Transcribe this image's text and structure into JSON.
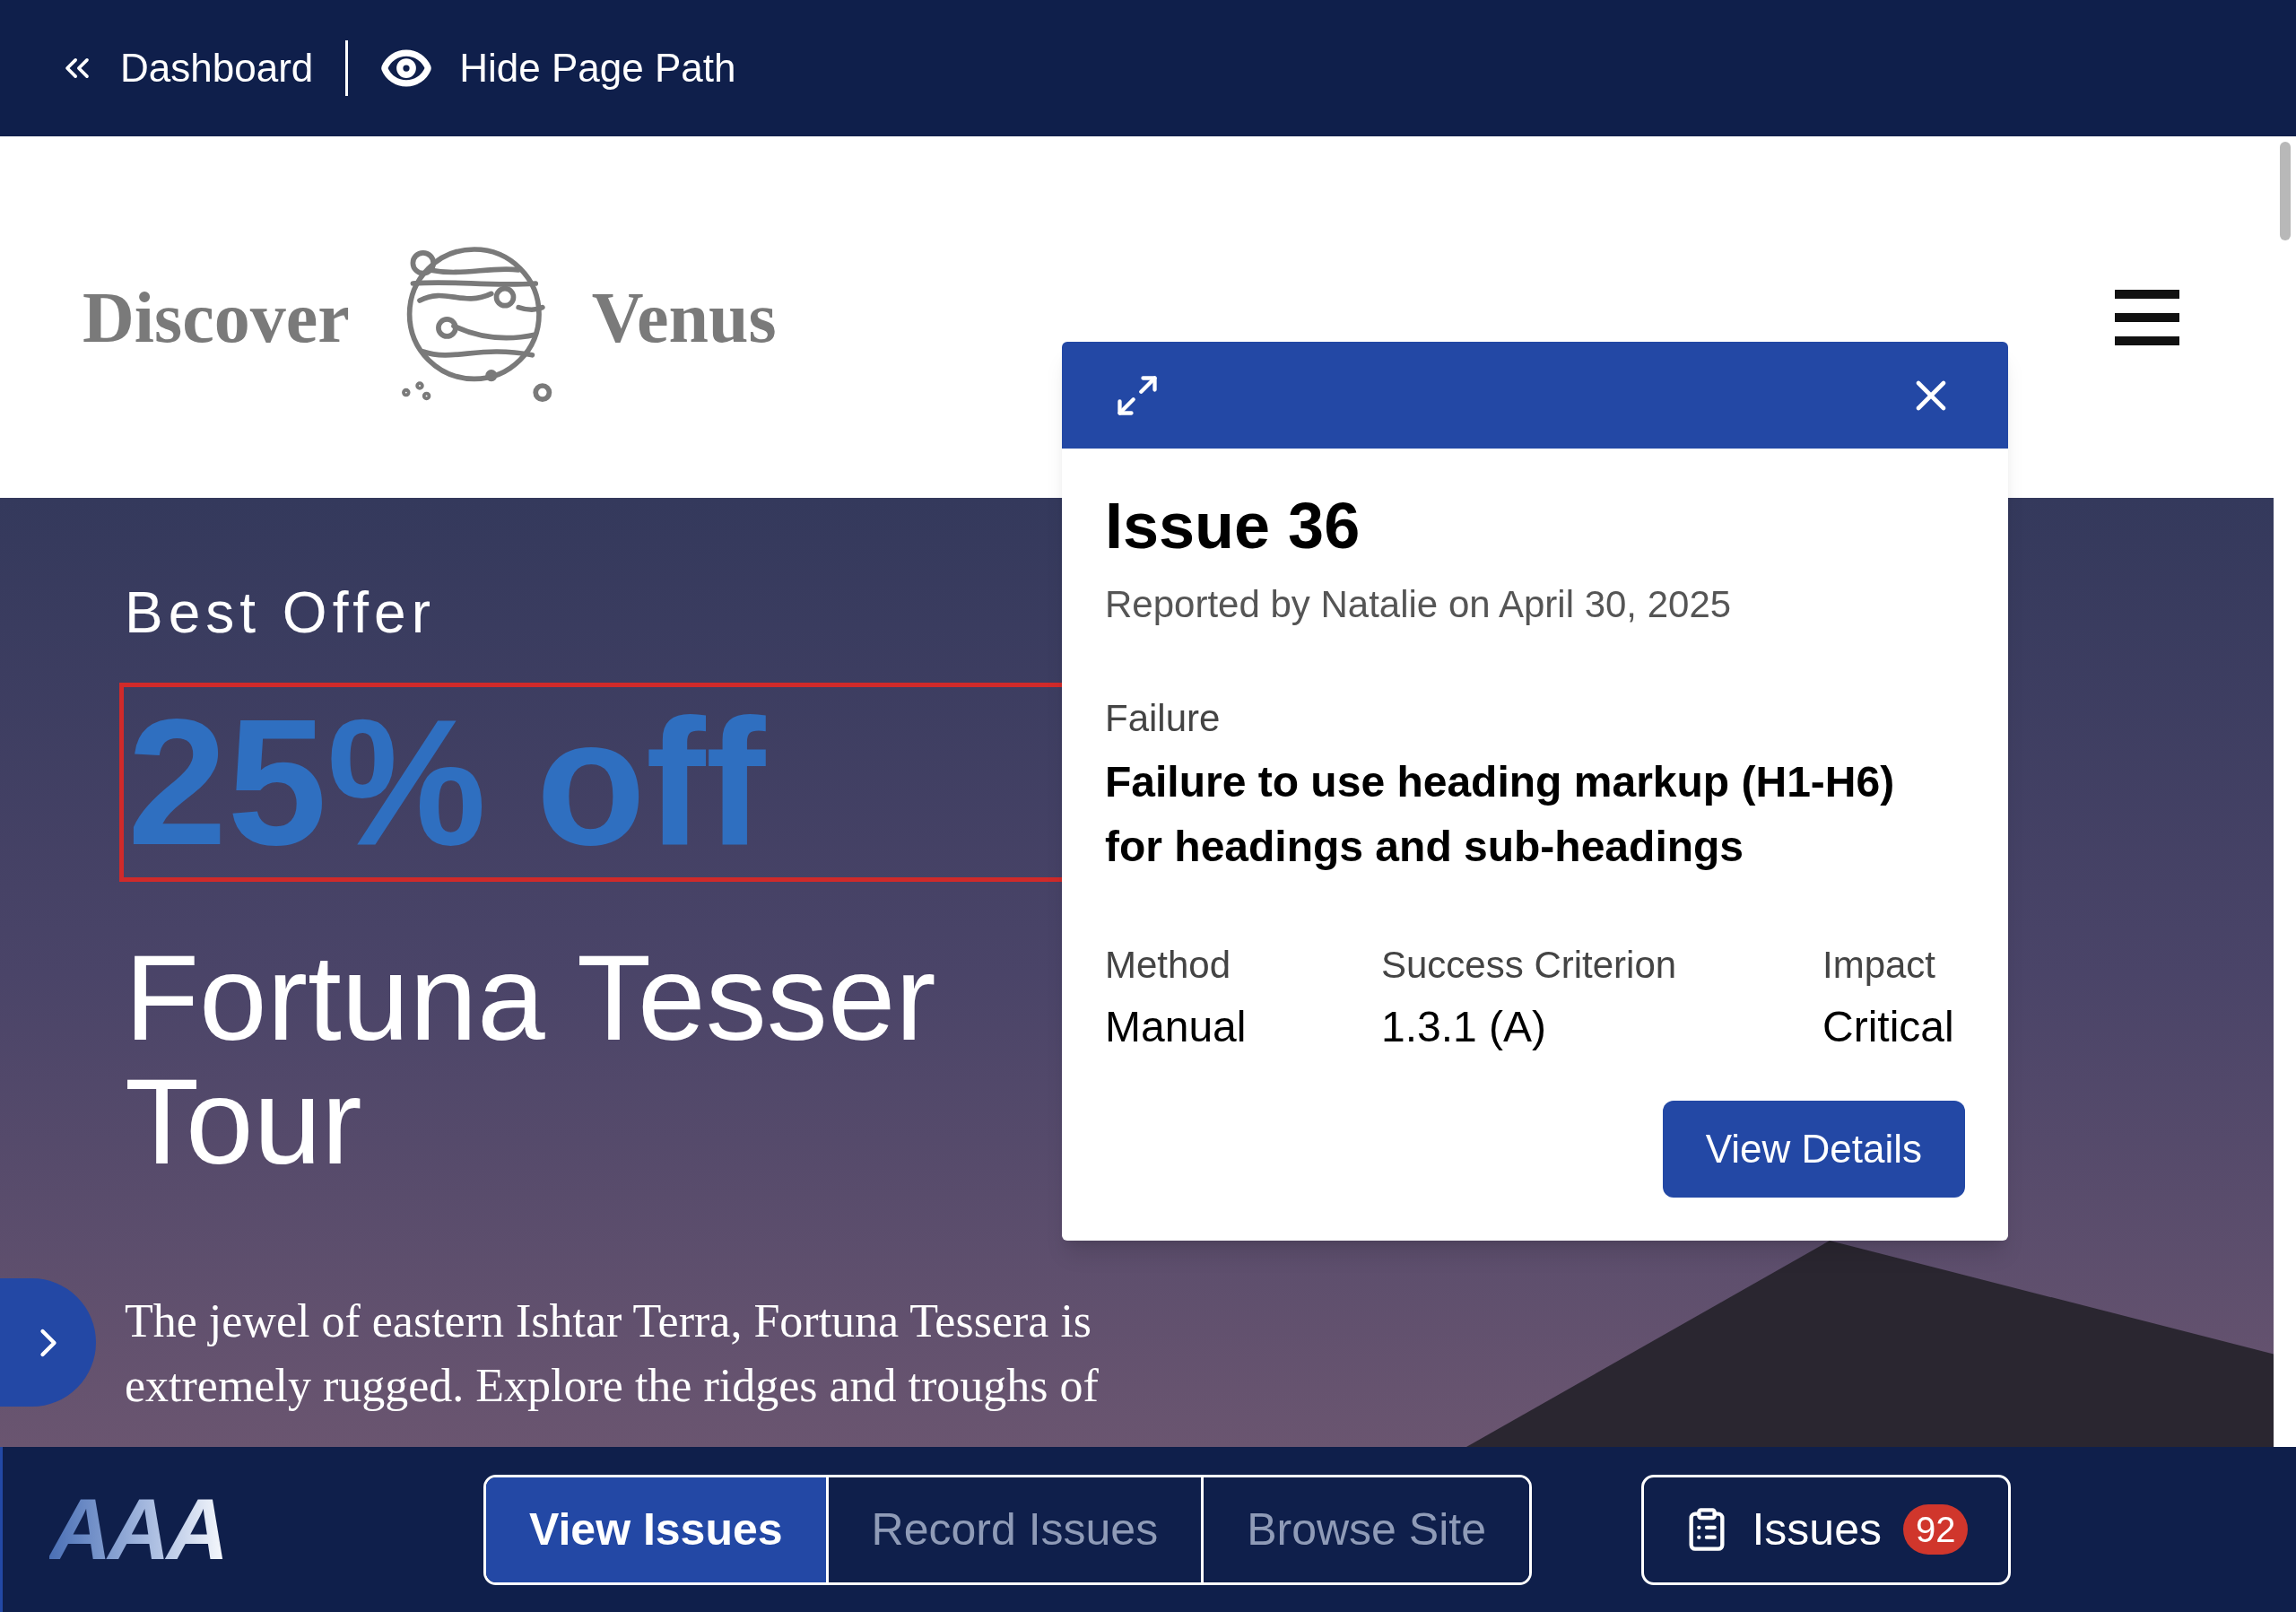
{
  "top_bar": {
    "back_label": "Dashboard",
    "toggle_label": "Hide Page Path"
  },
  "site": {
    "logo_left": "Discover",
    "logo_right": "Venus",
    "eyebrow": "Best Offer",
    "highlight": "25% off",
    "title_lines": [
      "Fortuna Tesser",
      "Tour"
    ],
    "intro": "The jewel of eastern Ishtar Terra, Fortuna Tessera is extremely rugged. Explore the ridges and troughs of"
  },
  "issue_popup": {
    "title": "Issue 36",
    "reported": "Reported by Natalie on April 30, 2025",
    "failure_label": "Failure",
    "failure_text": "Failure to use heading markup (H1-H6) for headings and sub-headings",
    "fields": [
      {
        "label": "Method",
        "value": "Manual"
      },
      {
        "label": "Success Criterion",
        "value": "1.3.1 (A)"
      },
      {
        "label": "Impact",
        "value": "Critical"
      }
    ],
    "button": "View Details"
  },
  "bottom_bar": {
    "logo_text": "AAA",
    "tabs": [
      {
        "label": "View Issues",
        "selected": true
      },
      {
        "label": "Record Issues",
        "selected": false
      },
      {
        "label": "Browse Site",
        "selected": false
      }
    ],
    "issues_button": {
      "label": "Issues",
      "count": "92"
    }
  }
}
